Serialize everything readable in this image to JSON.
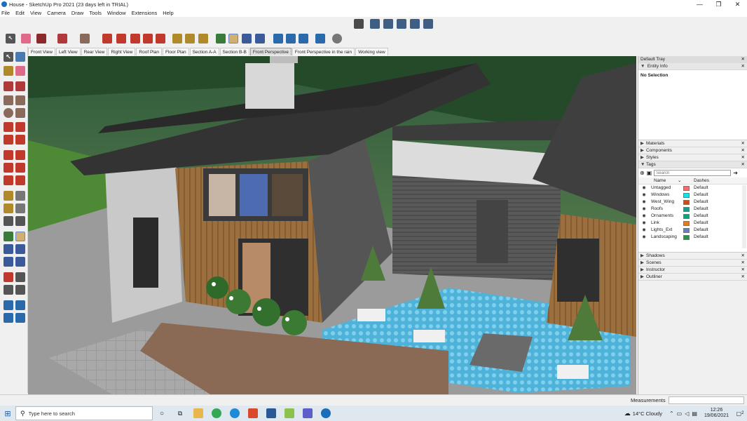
{
  "window": {
    "title": "House - SketchUp Pro 2021 (23 days left in TRIAL)",
    "min": "—",
    "max": "❐",
    "close": "✕"
  },
  "menu": [
    "File",
    "Edit",
    "View",
    "Camera",
    "Draw",
    "Tools",
    "Window",
    "Extensions",
    "Help"
  ],
  "scenes": [
    "Front View",
    "Left View",
    "Rear View",
    "Right View",
    "Roof Plan",
    "Floor Plan",
    "Section A-A",
    "Section B-B",
    "Front Perspective",
    "Front Perspective in the rain",
    "Working view"
  ],
  "active_scene": "Front Perspective",
  "tray": {
    "title": "Default Tray",
    "entity_info": "Entity Info",
    "selection": "No Selection",
    "panels_top": [
      "Materials",
      "Components",
      "Styles",
      "Tags"
    ],
    "panels_bottom": [
      "Shadows",
      "Scenes",
      "Instructor",
      "Outliner"
    ],
    "search_placeholder": "Search",
    "col_name": "Name",
    "col_dashes": "Dashes",
    "tags": [
      {
        "name": "Untagged",
        "color": "#f26d6d",
        "dash": "Default"
      },
      {
        "name": "Windows",
        "color": "#19e3de",
        "dash": "Default"
      },
      {
        "name": "West_Wing",
        "color": "#c0501c",
        "dash": "Default"
      },
      {
        "name": "Roofs",
        "color": "#1d9a8a",
        "dash": "Default"
      },
      {
        "name": "Ornaments",
        "color": "#14a07a",
        "dash": "Default"
      },
      {
        "name": "Link",
        "color": "#e07b24",
        "dash": "Default"
      },
      {
        "name": "Lights_Ext",
        "color": "#6d7fb0",
        "dash": "Default"
      },
      {
        "name": "Landscaping",
        "color": "#2f8f4a",
        "dash": "Default"
      }
    ]
  },
  "status": {
    "measurements": "Measurements"
  },
  "taskbar": {
    "search_placeholder": "Type here to search",
    "weather": "14°C  Cloudy",
    "time": "12:26",
    "date": "19/06/2021",
    "notifications": "2"
  }
}
